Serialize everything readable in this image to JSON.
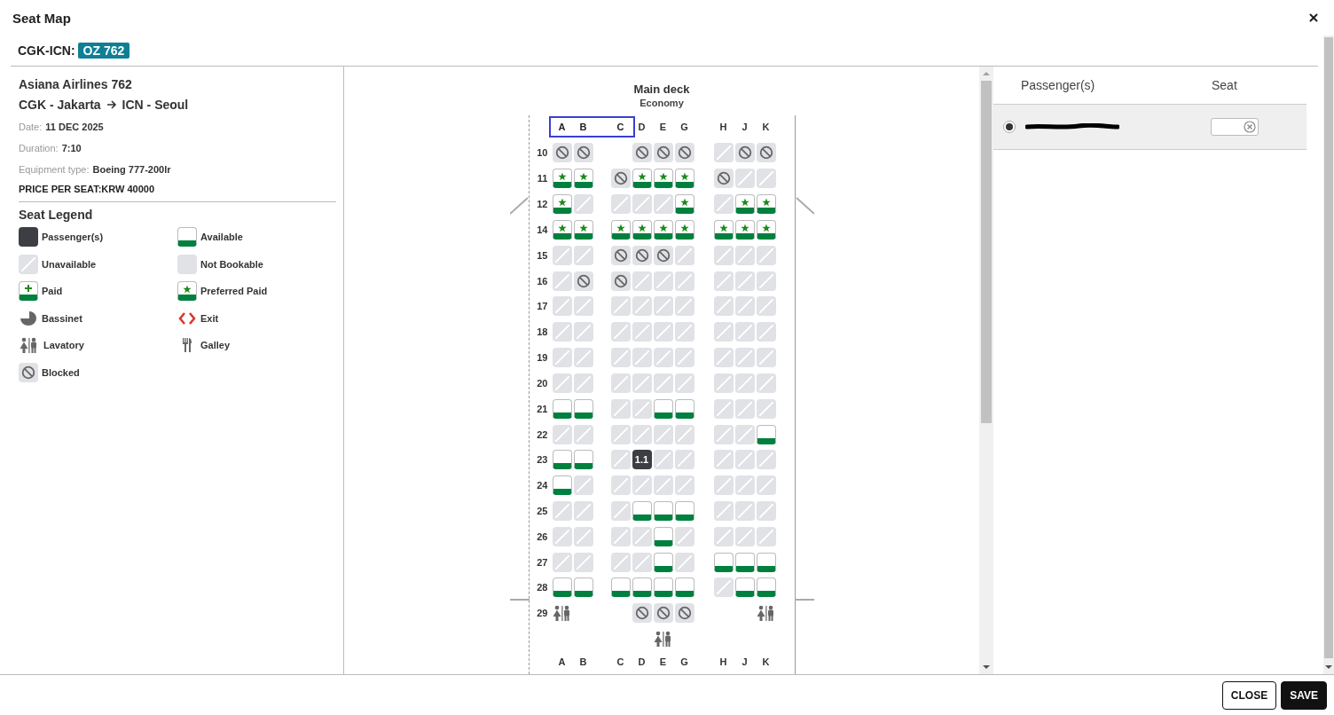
{
  "window": {
    "title": "Seat Map"
  },
  "flight": {
    "route": "CGK-ICN:",
    "number": "OZ 762"
  },
  "details": {
    "airline": "Asiana Airlines 762",
    "origin": "CGK - Jakarta",
    "destination": "ICN - Seoul",
    "fields": [
      {
        "label": "Date:",
        "value": "11 DEC 2025"
      },
      {
        "label": "Duration:",
        "value": "7:10"
      },
      {
        "label": "Equipment type:",
        "value": "Boeing 777-200lr"
      }
    ],
    "price": "PRICE PER SEAT:KRW 40000"
  },
  "legend": {
    "title": "Seat Legend",
    "items": [
      {
        "kind": "passenger",
        "label": "Passenger(s)"
      },
      {
        "kind": "available",
        "label": "Available"
      },
      {
        "kind": "unavailable",
        "label": "Unavailable"
      },
      {
        "kind": "notbookable",
        "label": "Not Bookable"
      },
      {
        "kind": "paid",
        "label": "Paid"
      },
      {
        "kind": "preferred",
        "label": "Preferred Paid"
      },
      {
        "kind": "bassinet",
        "label": "Bassinet"
      },
      {
        "kind": "exit",
        "label": "Exit"
      },
      {
        "kind": "lavatory",
        "label": "Lavatory"
      },
      {
        "kind": "galley",
        "label": "Galley"
      },
      {
        "kind": "blocked",
        "label": "Blocked"
      }
    ]
  },
  "deck": {
    "title": "Main deck",
    "cabin": "Economy",
    "columns": [
      {
        "letter": "A",
        "selected": true
      },
      {
        "letter": "B",
        "selected": true
      },
      {
        "letter": "C",
        "selected": true
      },
      {
        "letter": "D",
        "selected": false
      },
      {
        "letter": "E",
        "selected": false
      },
      {
        "letter": "G",
        "selected": false
      },
      {
        "letter": "H",
        "selected": false
      },
      {
        "letter": "J",
        "selected": false
      },
      {
        "letter": "K",
        "selected": false
      }
    ],
    "rows": [
      {
        "number": "10",
        "seats": [
          {
            "kind": "blocked"
          },
          {
            "kind": "blocked"
          },
          {
            "kind": "empty"
          },
          {
            "kind": "blocked"
          },
          {
            "kind": "blocked"
          },
          {
            "kind": "blocked"
          },
          {
            "kind": "unavailable"
          },
          {
            "kind": "blocked"
          },
          {
            "kind": "blocked"
          }
        ]
      },
      {
        "number": "11",
        "seats": [
          {
            "kind": "preferred"
          },
          {
            "kind": "preferred"
          },
          {
            "kind": "blocked"
          },
          {
            "kind": "preferred"
          },
          {
            "kind": "preferred"
          },
          {
            "kind": "preferred"
          },
          {
            "kind": "blocked"
          },
          {
            "kind": "unavailable"
          },
          {
            "kind": "unavailable"
          }
        ]
      },
      {
        "number": "12",
        "wing": {
          "kind": "angled"
        },
        "seats": [
          {
            "kind": "preferred"
          },
          {
            "kind": "unavailable"
          },
          {
            "kind": "unavailable"
          },
          {
            "kind": "unavailable"
          },
          {
            "kind": "unavailable"
          },
          {
            "kind": "preferred"
          },
          {
            "kind": "unavailable"
          },
          {
            "kind": "preferred"
          },
          {
            "kind": "preferred"
          }
        ]
      },
      {
        "number": "14",
        "seats": [
          {
            "kind": "preferred"
          },
          {
            "kind": "preferred"
          },
          {
            "kind": "preferred"
          },
          {
            "kind": "preferred"
          },
          {
            "kind": "preferred"
          },
          {
            "kind": "preferred"
          },
          {
            "kind": "preferred"
          },
          {
            "kind": "preferred"
          },
          {
            "kind": "preferred"
          }
        ]
      },
      {
        "number": "15",
        "seats": [
          {
            "kind": "unavailable"
          },
          {
            "kind": "unavailable"
          },
          {
            "kind": "blocked"
          },
          {
            "kind": "blocked"
          },
          {
            "kind": "blocked"
          },
          {
            "kind": "unavailable"
          },
          {
            "kind": "unavailable"
          },
          {
            "kind": "unavailable"
          },
          {
            "kind": "unavailable"
          }
        ]
      },
      {
        "number": "16",
        "seats": [
          {
            "kind": "unavailable"
          },
          {
            "kind": "blocked"
          },
          {
            "kind": "blocked"
          },
          {
            "kind": "unavailable"
          },
          {
            "kind": "unavailable"
          },
          {
            "kind": "unavailable"
          },
          {
            "kind": "unavailable"
          },
          {
            "kind": "unavailable"
          },
          {
            "kind": "unavailable"
          }
        ]
      },
      {
        "number": "17",
        "seats": [
          {
            "kind": "unavailable"
          },
          {
            "kind": "unavailable"
          },
          {
            "kind": "unavailable"
          },
          {
            "kind": "unavailable"
          },
          {
            "kind": "unavailable"
          },
          {
            "kind": "unavailable"
          },
          {
            "kind": "unavailable"
          },
          {
            "kind": "unavailable"
          },
          {
            "kind": "unavailable"
          }
        ]
      },
      {
        "number": "18",
        "seats": [
          {
            "kind": "unavailable"
          },
          {
            "kind": "unavailable"
          },
          {
            "kind": "unavailable"
          },
          {
            "kind": "unavailable"
          },
          {
            "kind": "unavailable"
          },
          {
            "kind": "unavailable"
          },
          {
            "kind": "unavailable"
          },
          {
            "kind": "unavailable"
          },
          {
            "kind": "unavailable"
          }
        ]
      },
      {
        "number": "19",
        "seats": [
          {
            "kind": "unavailable"
          },
          {
            "kind": "unavailable"
          },
          {
            "kind": "unavailable"
          },
          {
            "kind": "unavailable"
          },
          {
            "kind": "unavailable"
          },
          {
            "kind": "unavailable"
          },
          {
            "kind": "unavailable"
          },
          {
            "kind": "unavailable"
          },
          {
            "kind": "unavailable"
          }
        ]
      },
      {
        "number": "20",
        "seats": [
          {
            "kind": "unavailable"
          },
          {
            "kind": "unavailable"
          },
          {
            "kind": "unavailable"
          },
          {
            "kind": "unavailable"
          },
          {
            "kind": "unavailable"
          },
          {
            "kind": "unavailable"
          },
          {
            "kind": "unavailable"
          },
          {
            "kind": "unavailable"
          },
          {
            "kind": "unavailable"
          }
        ]
      },
      {
        "number": "21",
        "seats": [
          {
            "kind": "available"
          },
          {
            "kind": "available"
          },
          {
            "kind": "unavailable"
          },
          {
            "kind": "unavailable"
          },
          {
            "kind": "available"
          },
          {
            "kind": "available"
          },
          {
            "kind": "unavailable"
          },
          {
            "kind": "unavailable"
          },
          {
            "kind": "unavailable"
          }
        ]
      },
      {
        "number": "22",
        "seats": [
          {
            "kind": "unavailable"
          },
          {
            "kind": "unavailable"
          },
          {
            "kind": "unavailable"
          },
          {
            "kind": "unavailable"
          },
          {
            "kind": "unavailable"
          },
          {
            "kind": "unavailable"
          },
          {
            "kind": "unavailable"
          },
          {
            "kind": "unavailable"
          },
          {
            "kind": "available"
          }
        ]
      },
      {
        "number": "23",
        "seats": [
          {
            "kind": "available"
          },
          {
            "kind": "available"
          },
          {
            "kind": "unavailable"
          },
          {
            "kind": "passenger",
            "label": "1.1"
          },
          {
            "kind": "unavailable"
          },
          {
            "kind": "unavailable"
          },
          {
            "kind": "unavailable"
          },
          {
            "kind": "unavailable"
          },
          {
            "kind": "unavailable"
          }
        ]
      },
      {
        "number": "24",
        "seats": [
          {
            "kind": "available"
          },
          {
            "kind": "unavailable"
          },
          {
            "kind": "unavailable"
          },
          {
            "kind": "unavailable"
          },
          {
            "kind": "unavailable"
          },
          {
            "kind": "unavailable"
          },
          {
            "kind": "unavailable"
          },
          {
            "kind": "unavailable"
          },
          {
            "kind": "unavailable"
          }
        ]
      },
      {
        "number": "25",
        "seats": [
          {
            "kind": "unavailable"
          },
          {
            "kind": "unavailable"
          },
          {
            "kind": "unavailable"
          },
          {
            "kind": "available"
          },
          {
            "kind": "available"
          },
          {
            "kind": "available"
          },
          {
            "kind": "unavailable"
          },
          {
            "kind": "unavailable"
          },
          {
            "kind": "unavailable"
          }
        ]
      },
      {
        "number": "26",
        "seats": [
          {
            "kind": "unavailable"
          },
          {
            "kind": "unavailable"
          },
          {
            "kind": "unavailable"
          },
          {
            "kind": "unavailable"
          },
          {
            "kind": "available"
          },
          {
            "kind": "unavailable"
          },
          {
            "kind": "unavailable"
          },
          {
            "kind": "unavailable"
          },
          {
            "kind": "unavailable"
          }
        ]
      },
      {
        "number": "27",
        "seats": [
          {
            "kind": "unavailable"
          },
          {
            "kind": "unavailable"
          },
          {
            "kind": "unavailable"
          },
          {
            "kind": "unavailable"
          },
          {
            "kind": "available"
          },
          {
            "kind": "unavailable"
          },
          {
            "kind": "available"
          },
          {
            "kind": "available"
          },
          {
            "kind": "available"
          }
        ]
      },
      {
        "number": "28",
        "wing": {
          "kind": "level"
        },
        "seats": [
          {
            "kind": "available"
          },
          {
            "kind": "available"
          },
          {
            "kind": "available"
          },
          {
            "kind": "available"
          },
          {
            "kind": "available"
          },
          {
            "kind": "available"
          },
          {
            "kind": "unavailable"
          },
          {
            "kind": "available"
          },
          {
            "kind": "available"
          }
        ]
      },
      {
        "number": "29",
        "seats": [
          {
            "kind": "lavatory"
          },
          {
            "kind": "empty"
          },
          {
            "kind": "empty"
          },
          {
            "kind": "blocked"
          },
          {
            "kind": "blocked"
          },
          {
            "kind": "blocked"
          },
          {
            "kind": "empty"
          },
          {
            "kind": "empty"
          },
          {
            "kind": "lavatory"
          }
        ]
      },
      {
        "seats": [
          {
            "kind": "empty"
          },
          {
            "kind": "empty"
          },
          {
            "kind": "empty"
          },
          {
            "kind": "empty"
          },
          {
            "kind": "lavatory"
          },
          {
            "kind": "empty"
          },
          {
            "kind": "empty"
          },
          {
            "kind": "empty"
          },
          {
            "kind": "empty"
          }
        ]
      }
    ],
    "bottom_columns": [
      "A",
      "B",
      "C",
      "D",
      "E",
      "G",
      "H",
      "J",
      "K"
    ]
  },
  "passengers": {
    "columns": [
      "Passenger(s)",
      "Seat"
    ],
    "rows": [
      {
        "selected": true
      }
    ]
  },
  "buttons": [
    "CLOSE",
    "SAVE"
  ]
}
